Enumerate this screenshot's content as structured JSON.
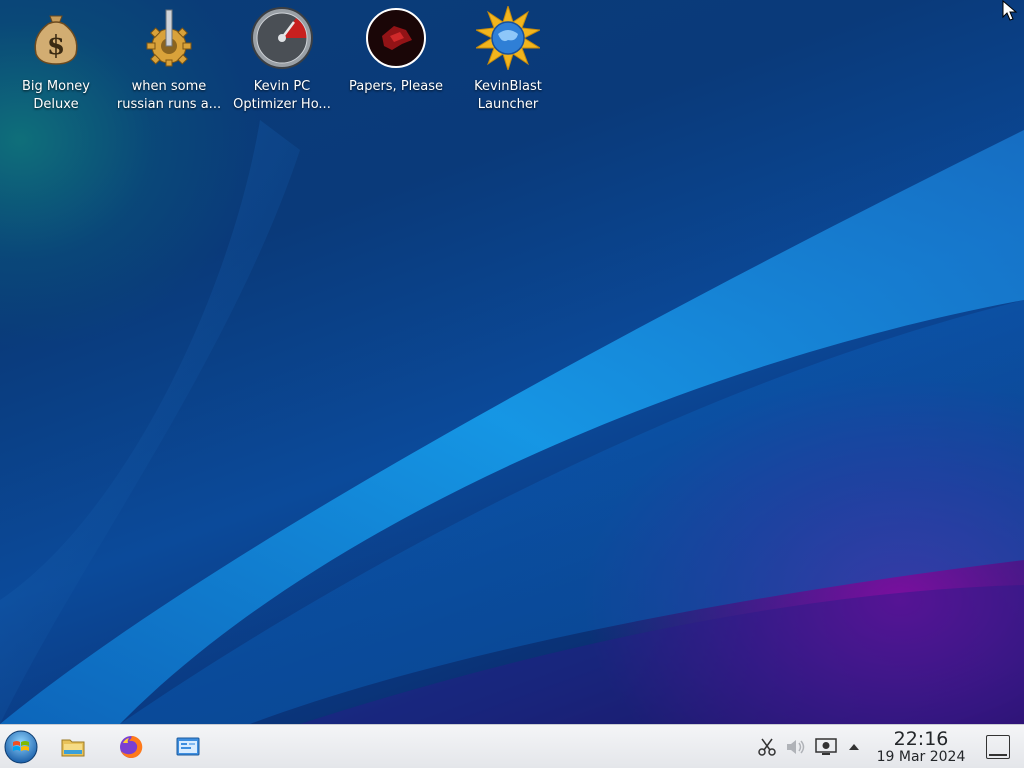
{
  "desktop": {
    "icons": [
      {
        "label": "Big Money\nDeluxe",
        "icon": "money-bag-icon"
      },
      {
        "label": "when some\nrussian runs a...",
        "icon": "gear-icon"
      },
      {
        "label": "Kevin PC\nOptimizer Ho...",
        "icon": "speedometer-icon"
      },
      {
        "label": "Papers, Please",
        "icon": "papers-please-icon"
      },
      {
        "label": "KevinBlast\nLauncher",
        "icon": "starburst-globe-icon"
      }
    ]
  },
  "taskbar": {
    "launchers": [
      {
        "icon": "start-menu-icon"
      },
      {
        "icon": "file-manager-icon"
      },
      {
        "icon": "firefox-icon"
      },
      {
        "icon": "system-settings-icon"
      }
    ],
    "tray": {
      "icons": [
        "scissors-icon",
        "volume-icon",
        "display-icon",
        "expand-arrow-icon"
      ],
      "time": "22:16",
      "date": "19 Mar 2024"
    }
  },
  "colors": {
    "accent_purple": "#7a0f9e",
    "wallpaper_blue": "#0b4a9a",
    "taskbar_bg": "#eff0f1"
  }
}
